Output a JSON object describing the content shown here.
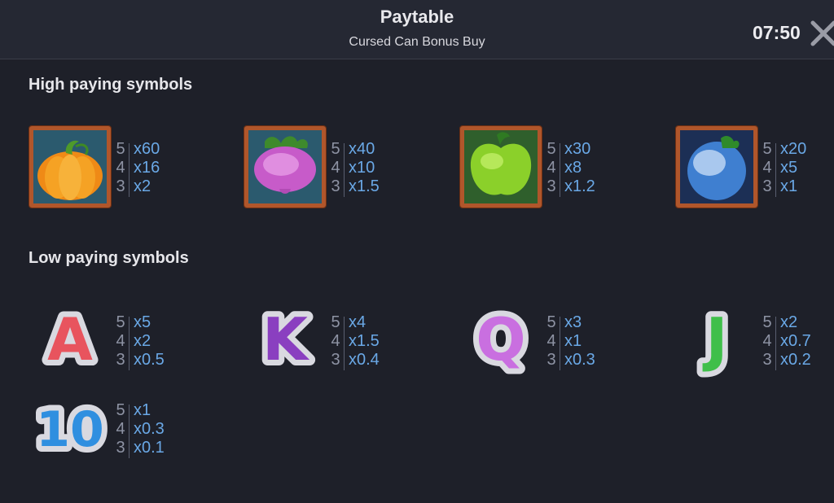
{
  "header": {
    "title": "Paytable",
    "subtitle": "Cursed Can Bonus Buy",
    "clock": "07:50",
    "close_icon": "close-icon"
  },
  "sections": {
    "high": "High paying symbols",
    "low": "Low paying symbols"
  },
  "high_symbols": [
    {
      "name": "pumpkin",
      "icon": "pumpkin-icon",
      "counts": [
        "5",
        "4",
        "3"
      ],
      "pays": [
        "x60",
        "x16",
        "x2"
      ]
    },
    {
      "name": "turnip",
      "icon": "turnip-icon",
      "counts": [
        "5",
        "4",
        "3"
      ],
      "pays": [
        "x40",
        "x10",
        "x1.5"
      ]
    },
    {
      "name": "apple",
      "icon": "apple-icon",
      "counts": [
        "5",
        "4",
        "3"
      ],
      "pays": [
        "x30",
        "x8",
        "x1.2"
      ]
    },
    {
      "name": "berry",
      "icon": "berry-icon",
      "counts": [
        "5",
        "4",
        "3"
      ],
      "pays": [
        "x20",
        "x5",
        "x1"
      ]
    }
  ],
  "low_symbols": [
    {
      "name": "A",
      "counts": [
        "5",
        "4",
        "3"
      ],
      "pays": [
        "x5",
        "x2",
        "x0.5"
      ],
      "color": "#e8545e"
    },
    {
      "name": "K",
      "counts": [
        "5",
        "4",
        "3"
      ],
      "pays": [
        "x4",
        "x1.5",
        "x0.4"
      ],
      "color": "#8a3fc0"
    },
    {
      "name": "Q",
      "counts": [
        "5",
        "4",
        "3"
      ],
      "pays": [
        "x3",
        "x1",
        "x0.3"
      ],
      "color": "#c96fe0"
    },
    {
      "name": "J",
      "counts": [
        "5",
        "4",
        "3"
      ],
      "pays": [
        "x2",
        "x0.7",
        "x0.2"
      ],
      "color": "#3fbf4a"
    },
    {
      "name": "10",
      "counts": [
        "5",
        "4",
        "3"
      ],
      "pays": [
        "x1",
        "x0.3",
        "x0.1"
      ],
      "color": "#2f8fe0"
    }
  ],
  "colors": {
    "background": "#1e2029",
    "header": "#252833",
    "multiplier": "#6aa8e6",
    "count": "#8e93a4",
    "frame": "#b0562b"
  }
}
